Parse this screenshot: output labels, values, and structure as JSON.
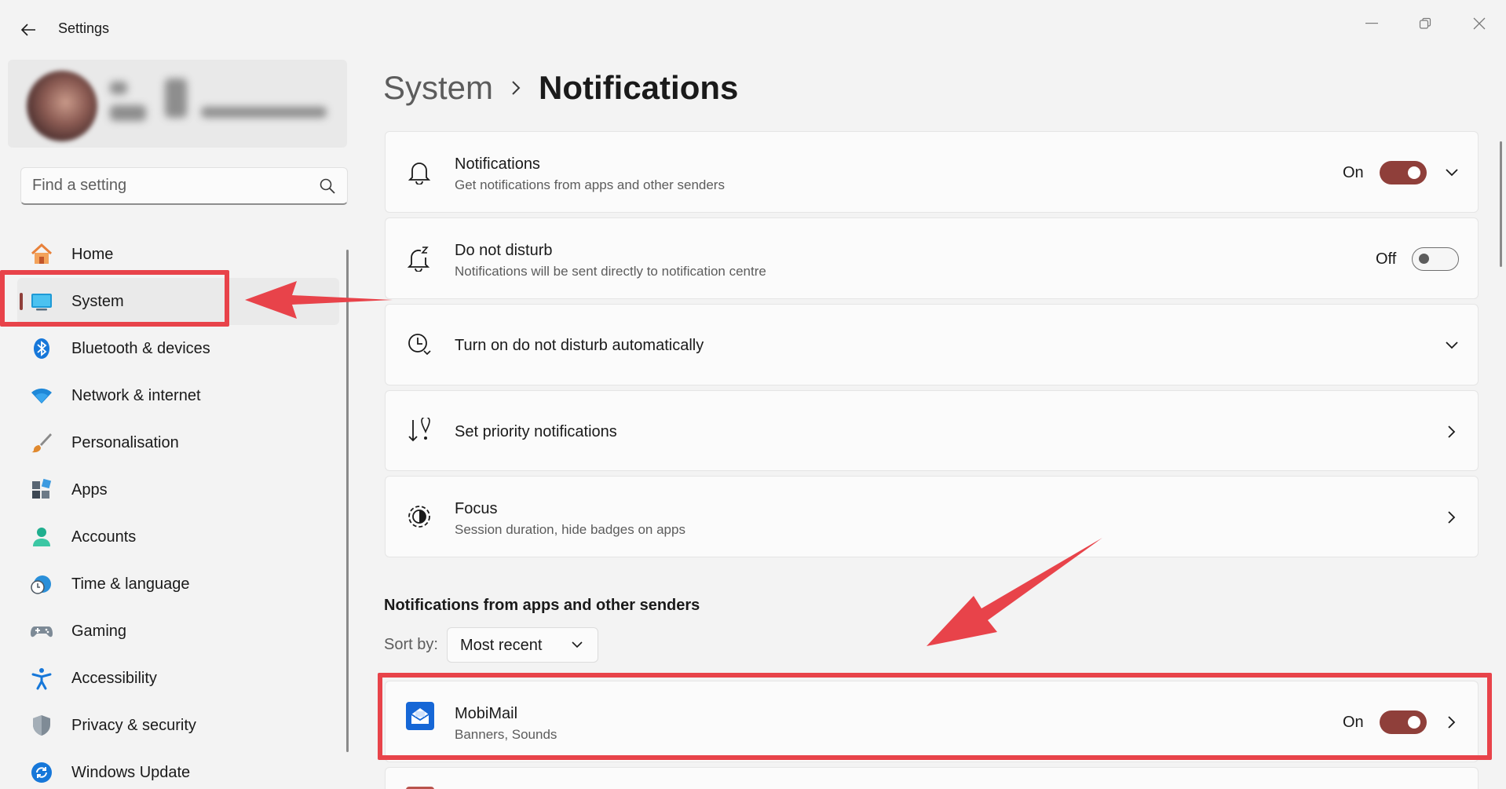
{
  "window": {
    "title": "Settings"
  },
  "search": {
    "placeholder": "Find a setting"
  },
  "sidebar": {
    "items": [
      {
        "label": "Home",
        "icon": "home-icon"
      },
      {
        "label": "System",
        "icon": "monitor-icon"
      },
      {
        "label": "Bluetooth & devices",
        "icon": "bluetooth-icon"
      },
      {
        "label": "Network & internet",
        "icon": "wifi-icon"
      },
      {
        "label": "Personalisation",
        "icon": "brush-icon"
      },
      {
        "label": "Apps",
        "icon": "apps-icon"
      },
      {
        "label": "Accounts",
        "icon": "person-icon"
      },
      {
        "label": "Time & language",
        "icon": "clock-globe-icon"
      },
      {
        "label": "Gaming",
        "icon": "gamepad-icon"
      },
      {
        "label": "Accessibility",
        "icon": "accessibility-icon"
      },
      {
        "label": "Privacy & security",
        "icon": "shield-icon"
      },
      {
        "label": "Windows Update",
        "icon": "refresh-icon"
      }
    ],
    "active_index": 1
  },
  "breadcrumb": {
    "parent": "System",
    "current": "Notifications"
  },
  "settings": [
    {
      "title": "Notifications",
      "subtitle": "Get notifications from apps and other senders",
      "icon": "bell-icon",
      "toggle_label": "On",
      "toggle_on": true,
      "trail": "chevron-down"
    },
    {
      "title": "Do not disturb",
      "subtitle": "Notifications will be sent directly to notification centre",
      "icon": "bell-snooze-icon",
      "toggle_label": "Off",
      "toggle_on": false
    },
    {
      "title": "Turn on do not disturb automatically",
      "icon": "clock-icon",
      "trail": "chevron-down"
    },
    {
      "title": "Set priority notifications",
      "icon": "priority-sort-icon",
      "trail": "chevron-right"
    },
    {
      "title": "Focus",
      "subtitle": "Session duration, hide badges on apps",
      "icon": "focus-icon",
      "trail": "chevron-right"
    }
  ],
  "apps_section": {
    "title": "Notifications from apps and other senders",
    "sort_label": "Sort by:",
    "sort_value": "Most recent",
    "apps": [
      {
        "name": "MobiMail",
        "detail": "Banners, Sounds",
        "icon": "mail-icon",
        "toggle_label": "On",
        "toggle_on": true
      }
    ]
  },
  "colors": {
    "accent": "#8f3f3a",
    "annotation": "#e8434a",
    "mail_app": "#1667d6"
  }
}
